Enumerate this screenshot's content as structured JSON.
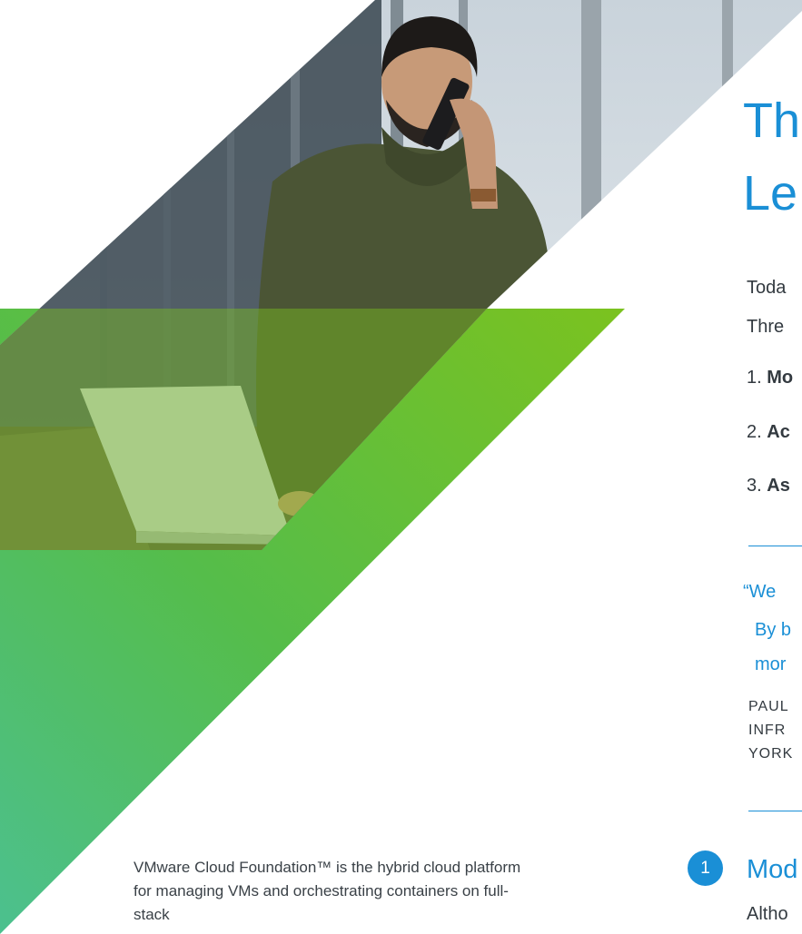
{
  "title": {
    "line1": "Th",
    "line2": "Le"
  },
  "intro": {
    "line1": "Toda",
    "line2": "Thre"
  },
  "list": [
    {
      "num": "1.",
      "bold": "Mo"
    },
    {
      "num": "2.",
      "bold": "Ac"
    },
    {
      "num": "3.",
      "bold": "As"
    }
  ],
  "quote": {
    "line1": "“We",
    "line2": "By b",
    "line3": "mor"
  },
  "attribution": {
    "line1": "PAUL",
    "line2": "INFR",
    "line3": "YORK"
  },
  "section": {
    "badge": "1",
    "heading": "Mod",
    "body": "Altho"
  },
  "caption": "VMware Cloud Foundation™ is the hybrid cloud platform for managing VMs and orchestrating containers on full-stack",
  "colors": {
    "accent_blue": "#1a8fd6",
    "gradient_green": "#6fbe2a",
    "gradient_teal": "#4cc08f",
    "text_dark": "#333a40"
  }
}
